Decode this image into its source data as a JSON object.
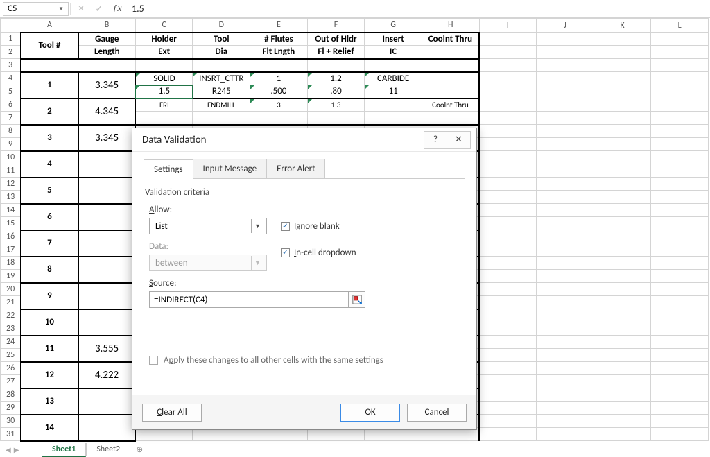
{
  "formula_bar": {
    "cell_ref": "C5",
    "value": "1.5"
  },
  "columns": [
    "A",
    "B",
    "C",
    "D",
    "E",
    "F",
    "G",
    "H",
    "I",
    "J",
    "K",
    "L"
  ],
  "headers": {
    "r1": [
      "",
      "Gauge",
      "Holder",
      "Tool",
      "# Flutes",
      "Out of Hldr",
      "Insert",
      "Coolnt Thru"
    ],
    "r2": [
      "Tool #",
      "Length",
      "Ext",
      "Dia",
      "Flt Lngth",
      "Fl + Relief",
      "IC",
      ""
    ]
  },
  "data_rows": {
    "r4": [
      "",
      "",
      "SOLID",
      "INSRT_CTTR",
      "1",
      "1.2",
      "CARBIDE",
      ""
    ],
    "r5": [
      "1",
      "3.345",
      "1.5",
      "R245",
      ".500",
      ".80",
      "11",
      ""
    ],
    "r6": [
      "",
      "",
      "FRI",
      "ENDMILL",
      "3",
      "1.3",
      "",
      "Coolnt Thru"
    ],
    "r7": [
      "2",
      "4.345"
    ],
    "r9": [
      "3",
      "3.345"
    ],
    "r11": [
      "4",
      ""
    ],
    "r13": [
      "5",
      ""
    ],
    "r15": [
      "6",
      ""
    ],
    "r17": [
      "7",
      ""
    ],
    "r19": [
      "8",
      ""
    ],
    "r21": [
      "9",
      ""
    ],
    "r23": [
      "10",
      ""
    ],
    "r25": [
      "11",
      "3.555"
    ],
    "r27": [
      "12",
      "4.222"
    ],
    "r29": [
      "13",
      ""
    ],
    "r31": [
      "14",
      ""
    ]
  },
  "dialog": {
    "title": "Data Validation",
    "tabs": {
      "settings": "Settings",
      "input_msg": "Input Message",
      "error_alert": "Error Alert"
    },
    "section": "Validation criteria",
    "allow_label": "Allow:",
    "allow_value": "List",
    "data_label": "Data:",
    "data_value": "between",
    "ignore_blank": "Ignore blank",
    "incell_dropdown": "In-cell dropdown",
    "source_label": "Source:",
    "source_value": "=INDIRECT(C4)",
    "apply_text": "Apply these changes to all other cells with the same settings",
    "clear_all": "Clear All",
    "ok": "OK",
    "cancel": "Cancel"
  },
  "sheet_tabs": {
    "active": "Sheet1",
    "other": "Sheet2"
  }
}
